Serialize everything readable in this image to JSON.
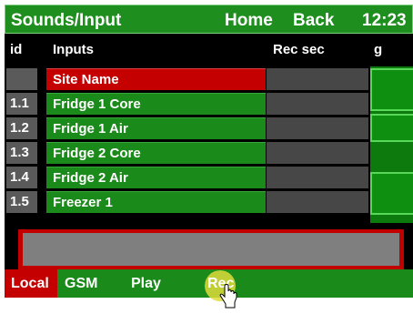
{
  "header": {
    "title": "Sounds/Input",
    "home_label": "Home",
    "back_label": "Back",
    "time": "12:23"
  },
  "columns": {
    "id": "id",
    "inputs": "Inputs",
    "rec_sec": "Rec sec",
    "g": "g"
  },
  "rows": [
    {
      "id": "",
      "name": "Site Name",
      "rec_sec": ""
    },
    {
      "id": "1.1",
      "name": "Fridge 1 Core",
      "rec_sec": ""
    },
    {
      "id": "1.2",
      "name": "Fridge 1 Air",
      "rec_sec": ""
    },
    {
      "id": "1.3",
      "name": "Fridge 2 Core",
      "rec_sec": ""
    },
    {
      "id": "1.4",
      "name": "Fridge 2 Air",
      "rec_sec": ""
    },
    {
      "id": "1.5",
      "name": "Freezer 1",
      "rec_sec": ""
    }
  ],
  "footer": {
    "local_label": "Local",
    "gsm_label": "GSM",
    "play_label": "Play",
    "rec_label": "Rec"
  },
  "colors": {
    "header_green": "#1e8e1e",
    "row_green": "#1a8a1a",
    "selected_red": "#c40000",
    "id_gray": "#5a5a5a",
    "rec_gray": "#474747",
    "cursor_highlight": "#dedA3c"
  },
  "icons": {
    "cursor": "hand-pointer-icon"
  }
}
